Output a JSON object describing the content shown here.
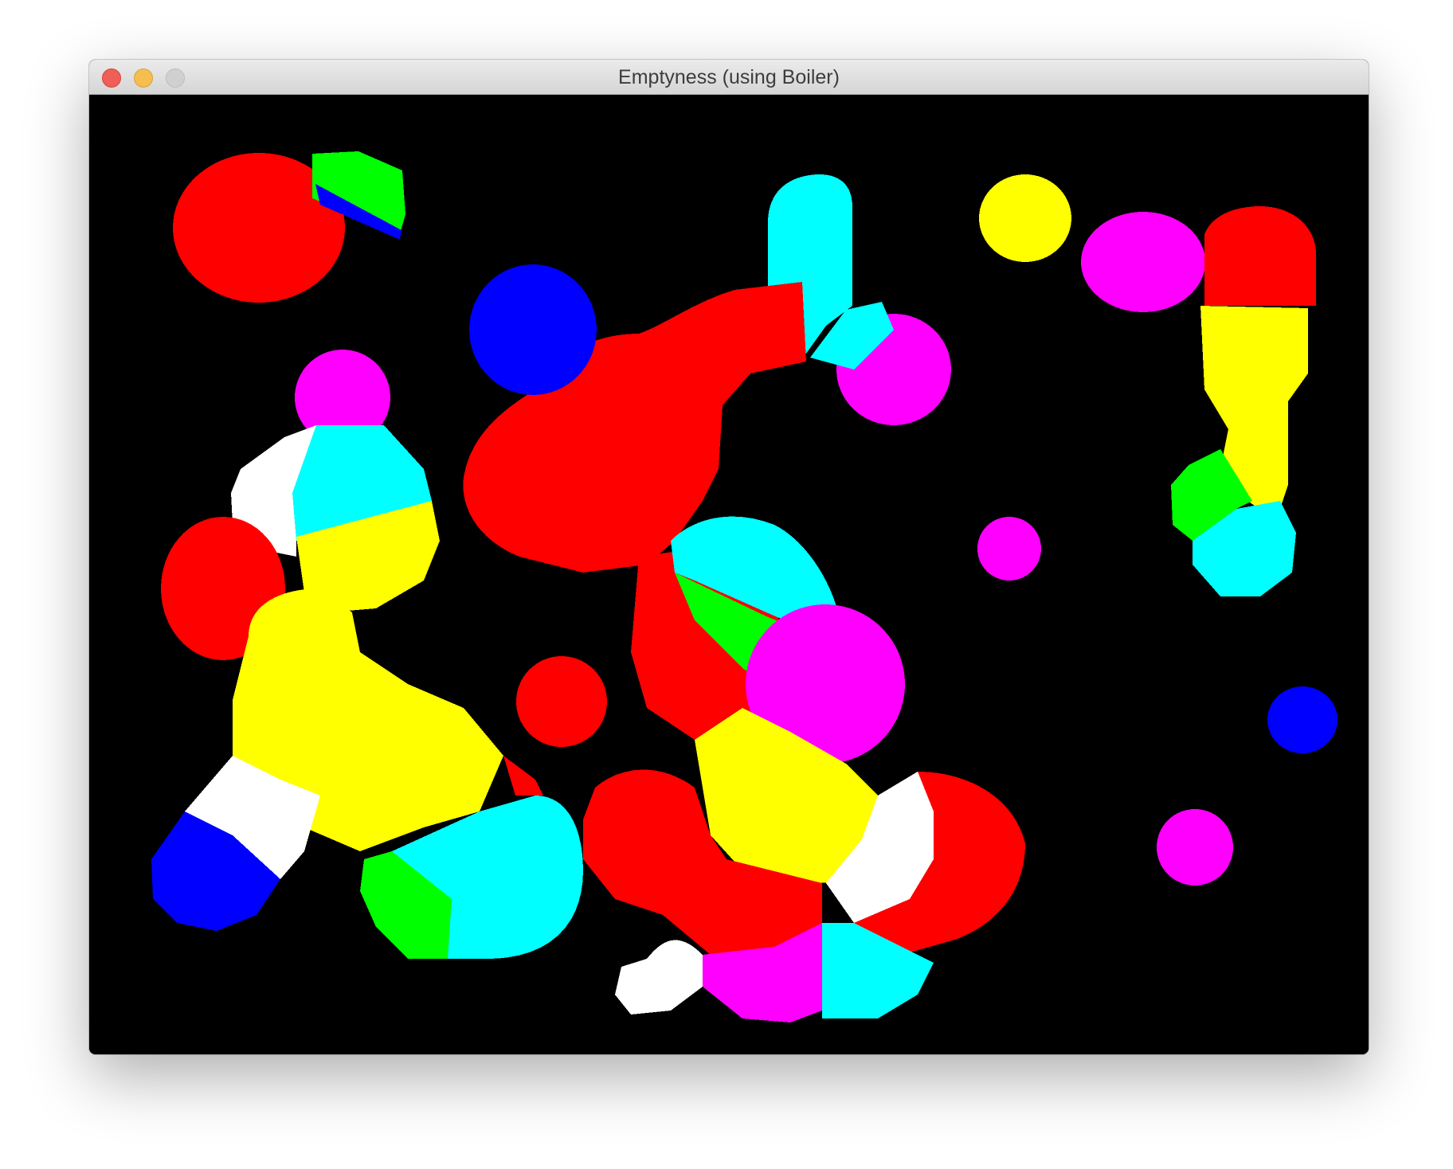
{
  "window": {
    "title": "Emptyness (using Boiler)",
    "controls": {
      "close": "close-button",
      "minimize": "minimize-button",
      "zoom": "zoom-button"
    }
  },
  "canvas": {
    "background": "#000000",
    "palette": {
      "red": "#ff0000",
      "green": "#00ff00",
      "blue": "#0000ff",
      "cyan": "#00ffff",
      "magenta": "#ff00ff",
      "yellow": "#ffff00",
      "white": "#ffffff"
    }
  }
}
